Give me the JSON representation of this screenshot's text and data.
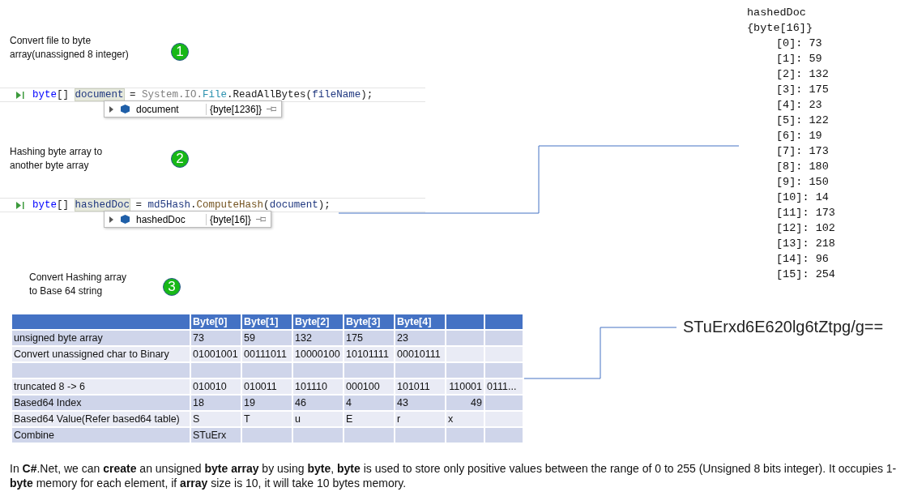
{
  "steps": [
    {
      "caption": "Convert file to byte array(unassigned 8 integer)",
      "number": "1",
      "code": [
        {
          "text": "byte",
          "kind": "keyword"
        },
        {
          "text": "[] ",
          "kind": "plain"
        },
        {
          "text": "document",
          "kind": "highlight"
        },
        {
          "text": " = ",
          "kind": "plain"
        },
        {
          "text": "System.IO.",
          "kind": "namespace"
        },
        {
          "text": "File",
          "kind": "type"
        },
        {
          "text": ".ReadAllBytes(",
          "kind": "plain"
        },
        {
          "text": "fileName",
          "kind": "ident"
        },
        {
          "text": ");",
          "kind": "plain"
        }
      ],
      "tooltip": {
        "name": "document",
        "value": "{byte[1236]}"
      }
    },
    {
      "caption": "Hashing byte array to another byte array",
      "number": "2",
      "code": [
        {
          "text": "byte",
          "kind": "keyword"
        },
        {
          "text": "[] ",
          "kind": "plain"
        },
        {
          "text": "hashedDoc",
          "kind": "highlight"
        },
        {
          "text": " = ",
          "kind": "plain"
        },
        {
          "text": "md5Hash",
          "kind": "ident"
        },
        {
          "text": ".",
          "kind": "plain"
        },
        {
          "text": "ComputeHash",
          "kind": "method"
        },
        {
          "text": "(",
          "kind": "plain"
        },
        {
          "text": "document",
          "kind": "ident"
        },
        {
          "text": ");",
          "kind": "plain"
        }
      ],
      "tooltip": {
        "name": "hashedDoc",
        "value": "{byte[16]}"
      }
    },
    {
      "caption": "Convert Hashing array to Base 64 string",
      "number": "3"
    }
  ],
  "watch": {
    "name": "hashedDoc",
    "type": "{byte[16]}",
    "items": [
      {
        "index": "[0]:",
        "value": "73"
      },
      {
        "index": "[1]:",
        "value": "59"
      },
      {
        "index": "[2]:",
        "value": "132"
      },
      {
        "index": "[3]:",
        "value": "175"
      },
      {
        "index": "[4]:",
        "value": "23"
      },
      {
        "index": "[5]:",
        "value": "122"
      },
      {
        "index": "[6]:",
        "value": "19"
      },
      {
        "index": "[7]:",
        "value": "173"
      },
      {
        "index": "[8]:",
        "value": "180"
      },
      {
        "index": "[9]:",
        "value": "150"
      },
      {
        "index": "[10]:",
        "value": "14"
      },
      {
        "index": "[11]:",
        "value": "173"
      },
      {
        "index": "[12]:",
        "value": "102"
      },
      {
        "index": "[13]:",
        "value": "218"
      },
      {
        "index": "[14]:",
        "value": "96"
      },
      {
        "index": "[15]:",
        "value": "254"
      }
    ]
  },
  "table": {
    "columns": [
      null,
      "Byte[0]",
      "Byte[1]",
      "Byte[2]",
      "Byte[3]",
      "Byte[4]",
      null,
      null
    ],
    "rows": [
      [
        {
          "text": "unsigned byte array"
        },
        {
          "text": "73"
        },
        {
          "text": "59"
        },
        {
          "text": "132"
        },
        {
          "text": "175"
        },
        {
          "text": "23"
        },
        null,
        null
      ],
      [
        {
          "text": "Convert unassigned char to Binary"
        },
        {
          "text": "01001001"
        },
        {
          "text": "00111011"
        },
        {
          "text": "10000100"
        },
        {
          "text": "10101111"
        },
        {
          "text": "00010111"
        },
        null,
        null
      ],
      [
        null,
        null,
        null,
        null,
        null,
        null,
        null,
        null
      ],
      [
        {
          "text": "truncated 8 -> 6"
        },
        {
          "text": "010010"
        },
        {
          "text": "010011"
        },
        {
          "text": "101110"
        },
        {
          "text": "000100"
        },
        {
          "text": "101011"
        },
        {
          "text": "110001",
          "right_aligned": true
        },
        {
          "text": "0111..."
        }
      ],
      [
        {
          "text": "Based64 Index"
        },
        {
          "text": "18"
        },
        {
          "text": "19"
        },
        {
          "text": "46"
        },
        {
          "text": "4"
        },
        {
          "text": "43"
        },
        {
          "text": "49",
          "right_aligned": true
        },
        null
      ],
      [
        {
          "text": "Based64 Value(Refer based64 table)"
        },
        {
          "text": "S"
        },
        {
          "text": "T"
        },
        {
          "text": "u"
        },
        {
          "text": "E"
        },
        {
          "text": "r"
        },
        {
          "text": "x"
        },
        null
      ],
      [
        {
          "text": "Combine"
        },
        {
          "text": "STuErx"
        },
        null,
        null,
        null,
        null,
        null,
        null
      ]
    ]
  },
  "result": "STuErxd6E620lg6tZtpg/g==",
  "description": "In **C#**.Net, we can **create** an unsigned **byte array** by using **byte**, **byte** is used to store only positive values between the range of 0 to 255 (Unsigned 8 bits integer). It occupies 1-**byte** memory for each element, if **array** size is 10, it will take 10 bytes memory."
}
